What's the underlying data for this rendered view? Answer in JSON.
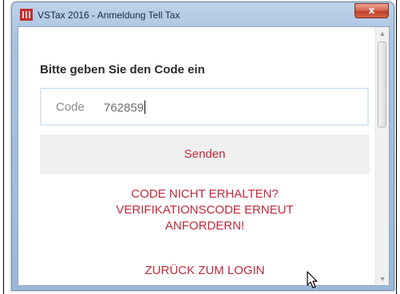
{
  "window": {
    "title": "VSTax 2016 - Anmeldung Tell Tax",
    "app_icon": "app-logo-icon",
    "close_label": "x"
  },
  "form": {
    "prompt": "Bitte geben Sie den Code ein",
    "code_label": "Code",
    "code_value": "762859",
    "send_label": "Senden",
    "resend_line1": "CODE NICHT ERHALTEN?",
    "resend_line2": "VERIFIKATIONSCODE ERNEUT",
    "resend_line3": "ANFORDERN!",
    "back_label": "ZURÜCK ZUM LOGIN"
  },
  "scrollbar": {
    "up_icon": "scroll-up-arrow-icon",
    "down_icon": "scroll-down-arrow-icon"
  },
  "colors": {
    "accent": "#c4283a",
    "button_bg": "#f0f0f0",
    "field_border": "#d9e8f6"
  }
}
